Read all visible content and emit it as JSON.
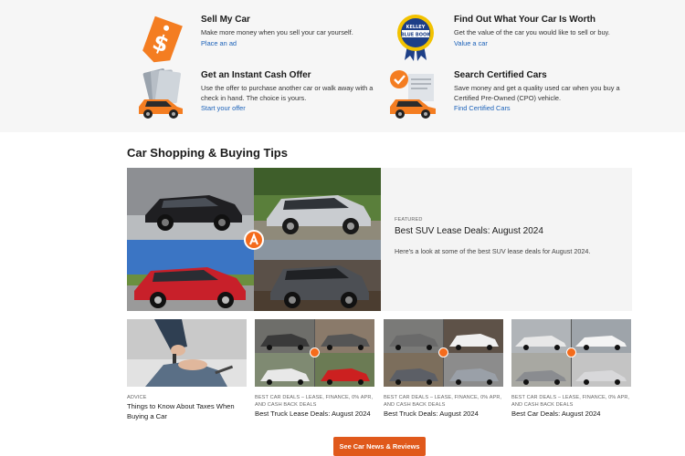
{
  "features": [
    {
      "title": "Sell My Car",
      "desc": "Make more money when you sell your car yourself.",
      "link": "Place an ad",
      "icon": "price-tag-icon"
    },
    {
      "title": "Find Out What Your Car Is Worth",
      "desc": "Get the value of the car you would like to sell or buy.",
      "link": "Value a car",
      "icon": "kelley-blue-book-icon",
      "kbb": {
        "top": "KELLEY",
        "mid": "BLUE BOOK"
      }
    },
    {
      "title": "Get an Instant Cash Offer",
      "desc": "Use the offer to purchase another car or walk away with a check in hand. The choice is yours.",
      "link": "Start your offer",
      "icon": "cash-car-icon"
    },
    {
      "title": "Search Certified Cars",
      "desc": "Save money and get a quality used car when you buy a Certified Pre-Owned (CPO) vehicle.",
      "link": "Find Certified Cars",
      "icon": "certified-car-icon"
    }
  ],
  "section_title": "Car Shopping & Buying Tips",
  "hero": {
    "eyebrow": "FEATURED",
    "title": "Best SUV Lease Deals: August 2024",
    "desc": "Here's a look at some of the best SUV lease deals for August 2024."
  },
  "cards": [
    {
      "eyebrow": "ADVICE",
      "title": "Things to Know About Taxes When Buying a Car"
    },
    {
      "eyebrow": "BEST CAR DEALS – LEASE, FINANCE, 0% APR, AND CASH BACK DEALS",
      "title": "Best Truck Lease Deals: August 2024"
    },
    {
      "eyebrow": "BEST CAR DEALS – LEASE, FINANCE, 0% APR, AND CASH BACK DEALS",
      "title": "Best Truck Deals: August 2024"
    },
    {
      "eyebrow": "BEST CAR DEALS – LEASE, FINANCE, 0% APR, AND CASH BACK DEALS",
      "title": "Best Car Deals: August 2024"
    }
  ],
  "cta_label": "See Car News & Reviews",
  "colors": {
    "accent": "#e0591b",
    "link": "#1c62b9",
    "band": "#f6f6f6"
  }
}
